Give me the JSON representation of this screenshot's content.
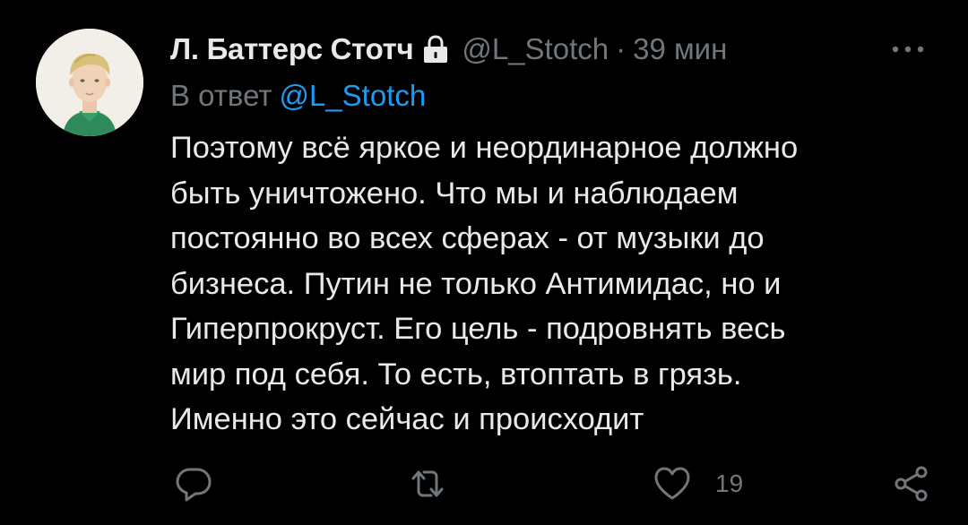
{
  "tweet": {
    "display_name": "Л. Баттерс Стотч",
    "handle": "@L_Stotch",
    "separator": "·",
    "time": "39 мин",
    "reply_prefix": "В ответ",
    "reply_mention": "@L_Stotch",
    "body_lines": [
      "Поэтому всё яркое и неординарное должно",
      "быть уничтожено. Что мы и наблюдаем",
      "постоянно во всех сферах - от музыки до",
      "бизнеса. Путин не только Антимидас, но и",
      "Гиперпрокруст. Его цель - подровнять весь",
      "мир под себя. То есть, втоптать в грязь.",
      "Именно это сейчас и происходит"
    ],
    "actions": {
      "reply_count": "",
      "retweet_count": "",
      "like_count": "19"
    }
  },
  "icons": {
    "protected": "lock-icon",
    "more": "more-horizontal-icon",
    "reply": "reply-icon",
    "retweet": "retweet-icon",
    "like": "heart-icon",
    "share": "share-icon"
  },
  "colors": {
    "background": "#000000",
    "text": "#e7e9ea",
    "secondary": "#71767b",
    "accent": "#1d9bf0"
  }
}
